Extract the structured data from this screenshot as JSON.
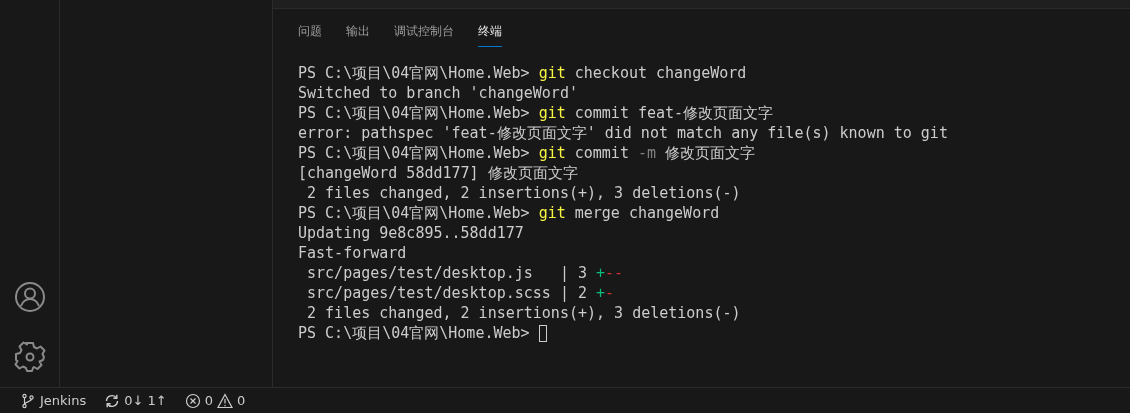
{
  "panel": {
    "tabs": [
      {
        "label": "问题",
        "selected": false
      },
      {
        "label": "输出",
        "selected": false
      },
      {
        "label": "调试控制台",
        "selected": false
      },
      {
        "label": "终端",
        "selected": true
      }
    ]
  },
  "terminal": {
    "cursor": true,
    "lines": [
      [
        {
          "kind": "plain",
          "text": "PS C:\\项目\\04官网\\Home.Web> "
        },
        {
          "kind": "command",
          "text": "git"
        },
        {
          "kind": "plain",
          "text": " checkout changeWord"
        }
      ],
      [
        {
          "kind": "plain",
          "text": "Switched to branch 'changeWord'"
        }
      ],
      [
        {
          "kind": "plain",
          "text": "PS C:\\项目\\04官网\\Home.Web> "
        },
        {
          "kind": "command",
          "text": "git"
        },
        {
          "kind": "plain",
          "text": " commit feat-修改页面文字"
        }
      ],
      [
        {
          "kind": "plain",
          "text": "error: pathspec 'feat-修改页面文字' did not match any file(s) known to git"
        }
      ],
      [
        {
          "kind": "plain",
          "text": "PS C:\\项目\\04官网\\Home.Web> "
        },
        {
          "kind": "command",
          "text": "git"
        },
        {
          "kind": "plain",
          "text": " commit "
        },
        {
          "kind": "flag",
          "text": "-m"
        },
        {
          "kind": "plain",
          "text": " 修改页面文字"
        }
      ],
      [
        {
          "kind": "plain",
          "text": "[changeWord 58dd177] 修改页面文字"
        }
      ],
      [
        {
          "kind": "plain",
          "text": " 2 files changed, 2 insertions(+), 3 deletions(-)"
        }
      ],
      [
        {
          "kind": "plain",
          "text": "PS C:\\项目\\04官网\\Home.Web> "
        },
        {
          "kind": "command",
          "text": "git"
        },
        {
          "kind": "plain",
          "text": " merge changeWord"
        }
      ],
      [
        {
          "kind": "plain",
          "text": "Updating 9e8c895..58dd177"
        }
      ],
      [
        {
          "kind": "plain",
          "text": "Fast-forward"
        }
      ],
      [
        {
          "kind": "plain",
          "text": " src/pages/test/desktop.js   | 3 "
        },
        {
          "kind": "added",
          "text": "+"
        },
        {
          "kind": "removed",
          "text": "--"
        }
      ],
      [
        {
          "kind": "plain",
          "text": " src/pages/test/desktop.scss | 2 "
        },
        {
          "kind": "added",
          "text": "+"
        },
        {
          "kind": "removed",
          "text": "-"
        }
      ],
      [
        {
          "kind": "plain",
          "text": " 2 files changed, 2 insertions(+), 3 deletions(-)"
        }
      ],
      [
        {
          "kind": "plain",
          "text": "PS C:\\项目\\04官网\\Home.Web> "
        }
      ]
    ]
  },
  "status_bar": {
    "branch": "Jenkins",
    "sync": "0↓ 1↑",
    "errors": "0",
    "warnings": "0"
  }
}
